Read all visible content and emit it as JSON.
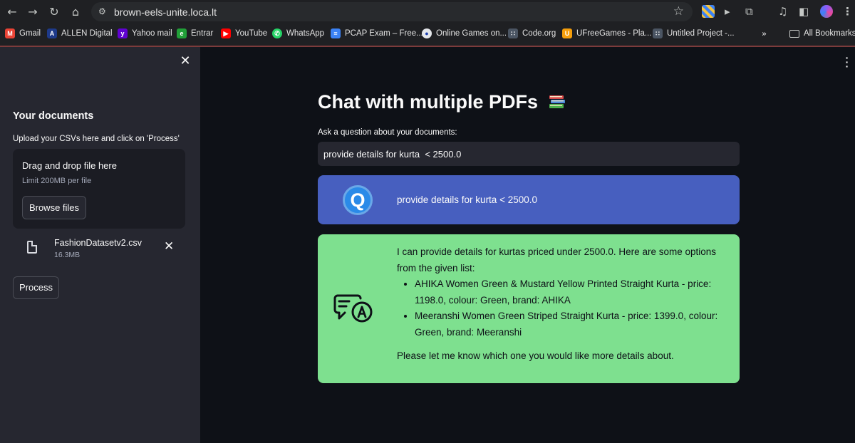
{
  "browser": {
    "url": "brown-eels-unite.loca.lt",
    "bookmarks": [
      {
        "label": "Gmail",
        "color": "#ea4335"
      },
      {
        "label": "ALLEN Digital",
        "color": "#1e3a8a"
      },
      {
        "label": "Yahoo mail",
        "color": "#6001d2"
      },
      {
        "label": "Entrar",
        "color": "#21a038"
      },
      {
        "label": "YouTube",
        "color": "#ff0000"
      },
      {
        "label": "WhatsApp",
        "color": "#25d366"
      },
      {
        "label": "PCAP Exam – Free...",
        "color": "#3b82f6"
      },
      {
        "label": "Online Games on...",
        "color": "#e5e7eb"
      },
      {
        "label": "Code.org",
        "color": "#9ca3af"
      },
      {
        "label": "UFreeGames - Pla...",
        "color": "#f59e0b"
      },
      {
        "label": "Untitled Project -...",
        "color": "#9ca3af"
      }
    ],
    "all_bookmarks": "All Bookmarks"
  },
  "sidebar": {
    "title": "Your documents",
    "upload_label": "Upload your CSVs here and click on 'Process'",
    "dropzone": {
      "title": "Drag and drop file here",
      "limit": "Limit 200MB per file",
      "browse_label": "Browse files"
    },
    "file": {
      "name": "FashionDatasetv2.csv",
      "size": "16.3MB"
    },
    "process_label": "Process"
  },
  "main": {
    "title": "Chat with multiple PDFs",
    "question_label": "Ask a question about your documents:",
    "question_value": "provide details for kurta  < 2500.0",
    "user_message": "provide details for kurta < 2500.0",
    "bot_message": {
      "intro": "I can provide details for kurtas priced under 2500.0. Here are some options from the given list:",
      "items": [
        "AHIKA Women Green & Mustard Yellow Printed Straight Kurta - price: 1198.0, colour: Green, brand: AHIKA",
        "Meeranshi Women Green Striped Straight Kurta - price: 1399.0, colour: Green, brand: Meeranshi"
      ],
      "closing": "Please let me know which one you would like more details about."
    },
    "avatar_user": "Q"
  },
  "colors": {
    "app_bg": "#0e1117",
    "sidebar_bg": "#262730",
    "user_msg_bg": "#475fbf",
    "bot_msg_bg": "#7ee08f"
  }
}
